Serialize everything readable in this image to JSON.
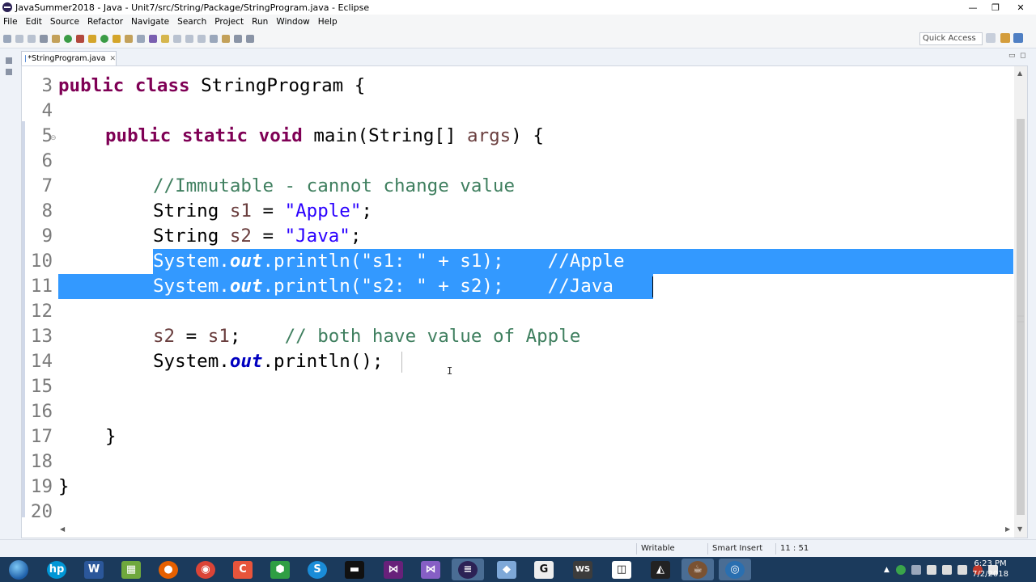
{
  "window": {
    "title": "JavaSummer2018 - Java - Unit7/src/String/Package/StringProgram.java - Eclipse"
  },
  "menu": [
    "File",
    "Edit",
    "Source",
    "Refactor",
    "Navigate",
    "Search",
    "Project",
    "Run",
    "Window",
    "Help"
  ],
  "toolbar": {
    "quick_access_placeholder": "Quick Access"
  },
  "editor_tab": {
    "label": "*StringProgram.java"
  },
  "code_lines": [
    {
      "num": "3"
    },
    {
      "num": "4"
    },
    {
      "num": "5"
    },
    {
      "num": "6"
    },
    {
      "num": "7"
    },
    {
      "num": "8"
    },
    {
      "num": "9"
    },
    {
      "num": "10"
    },
    {
      "num": "11"
    },
    {
      "num": "12"
    },
    {
      "num": "13"
    },
    {
      "num": "14"
    },
    {
      "num": "15"
    },
    {
      "num": "16"
    },
    {
      "num": "17"
    },
    {
      "num": "18"
    },
    {
      "num": "19"
    },
    {
      "num": "20"
    }
  ],
  "code": {
    "l3": {
      "kw1": "public",
      "kw2": "class",
      "rest": " StringProgram {"
    },
    "l5": {
      "kw1": "public",
      "kw2": "static",
      "kw3": "void",
      "rest1": " main(String[] ",
      "param": "args",
      "rest2": ") {"
    },
    "l7": {
      "comment": "//Immutable - cannot change value"
    },
    "l8": {
      "pre": "String ",
      "var": "s1",
      "mid": " = ",
      "str": "\"Apple\"",
      "end": ";"
    },
    "l9": {
      "pre": "String ",
      "var": "s2",
      "mid": " = ",
      "str": "\"Java\"",
      "end": ";"
    },
    "l10": {
      "pre": "System.",
      "fld": "out",
      "rest": ".println(\"s1: \" + s1);    //Apple"
    },
    "l11": {
      "pre": "System.",
      "fld": "out",
      "rest": ".println(\"s2: \" + s2);    //Java"
    },
    "l13": {
      "var": "s2",
      "mid": " = ",
      "var2": "s1",
      "end": ";    ",
      "comment": "// both have value of Apple"
    },
    "l14": {
      "pre": "System.",
      "fld": "out",
      "rest": ".println();"
    },
    "l17": {
      "brace": "}"
    },
    "l19": {
      "brace": "}"
    }
  },
  "status": {
    "writable": "Writable",
    "insert_mode": "Smart Insert",
    "position": "11 : 51"
  },
  "clock": {
    "time": "6:23 PM",
    "date": "7/2/2018"
  },
  "colors": {
    "selection": "#3399ff",
    "keyword": "#7f0055",
    "comment": "#3f7f5f",
    "string": "#2a00ff",
    "field": "#0000c0",
    "taskbar": "#1b3a5c"
  },
  "taskbar_apps": [
    "hp-icon",
    "word-icon",
    "calculator-icon",
    "firefox-icon",
    "chrome-icon",
    "app-icon",
    "geogebra-icon",
    "skype-icon",
    "explorer-icon",
    "visual-studio-icon",
    "visual-studio-icon",
    "eclipse-icon",
    "virtualbox-icon",
    "g-icon",
    "ws-icon",
    "window-icon",
    "unity-icon",
    "java-icon",
    "record-icon"
  ]
}
